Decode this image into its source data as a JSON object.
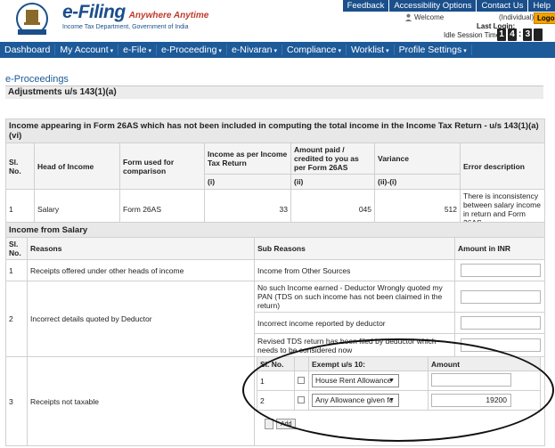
{
  "brand": {
    "name": "e-Filing",
    "tagline": "Anywhere Anytime",
    "subtitle": "Income Tax Department, Government of India"
  },
  "top_links": [
    "Feedback",
    "Accessibility Options",
    "Contact Us",
    "Help"
  ],
  "user": {
    "welcome": "Welcome",
    "type": "(Individual)",
    "logout": "Logout",
    "last_login": "Last Login:",
    "idle_label": "Idle Session Timer",
    "timer": [
      "1",
      "4",
      "3",
      ""
    ]
  },
  "nav": [
    "Dashboard",
    "My Account",
    "e-File",
    "e-Proceeding",
    "e-Nivaran",
    "Compliance",
    "Worklist",
    "Profile Settings"
  ],
  "page": {
    "title": "e-Proceedings",
    "section": "Adjustments u/s 143(1)(a)"
  },
  "table1": {
    "caption": "Income appearing in Form 26AS which has not been included in computing the total income in the Income Tax Return - u/s 143(1)(a)(vi)",
    "headers": [
      "Sl. No.",
      "Head of Income",
      "Form used for comparison",
      "Income as per Income Tax Return",
      "Amount paid / credited to you as per Form 26AS",
      "Variance",
      "Error description"
    ],
    "subheaders": [
      "(i)",
      "(ii)",
      "(ii)-(i)"
    ],
    "row": {
      "sl": "1",
      "head": "Salary",
      "form": "Form 26AS",
      "income": "33",
      "amount": "045",
      "variance": "512",
      "error": "There is inconsistency between salary income in return and Form 26AS"
    }
  },
  "table2": {
    "caption": "Income from Salary",
    "headers": [
      "Sl. No.",
      "Reasons",
      "Sub Reasons",
      "Amount in INR"
    ],
    "rows": [
      {
        "sl": "1",
        "reason": "Receipts offered under other heads of income",
        "sub": [
          "Income from Other Sources"
        ]
      },
      {
        "sl": "2",
        "reason": "Incorrect details quoted by Deductor",
        "sub": [
          "No such Income earned - Deductor Wrongly quoted my PAN (TDS on such income has not been claimed in the return)",
          "Incorrect income reported by deductor",
          "Revised TDS return has been filed by deductor which needs to be considered now"
        ]
      },
      {
        "sl": "3",
        "reason": "Receipts not taxable"
      }
    ],
    "nested": {
      "headers": [
        "Sl. No.",
        "Exempt u/s 10:",
        "Amount"
      ],
      "rows": [
        {
          "sl": "1",
          "option": "House Rent Allowance",
          "amount": ""
        },
        {
          "sl": "2",
          "option": "Any Allowance given fc",
          "amount": "19200"
        }
      ],
      "buttons": [
        "",
        "Add"
      ]
    }
  }
}
